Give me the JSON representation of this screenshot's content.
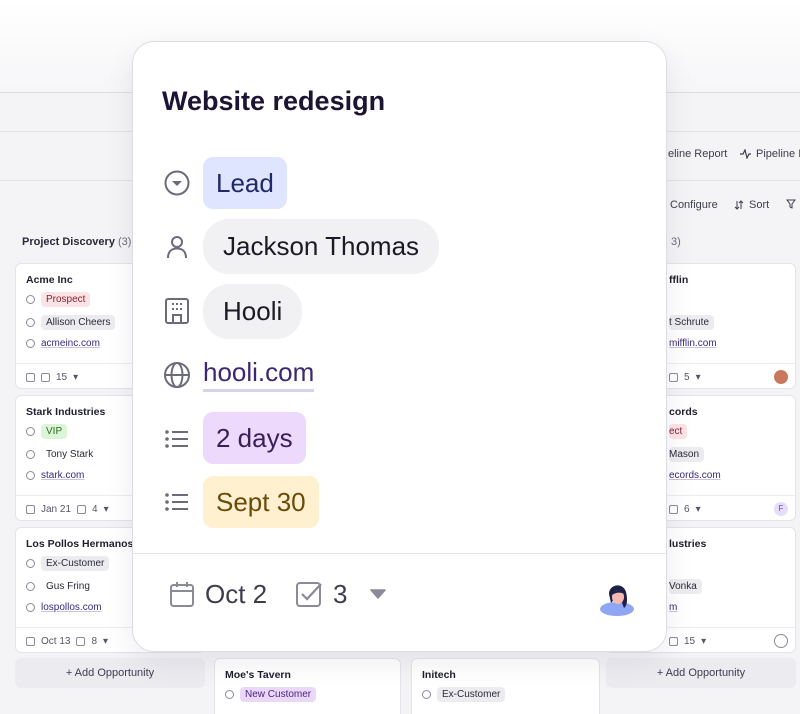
{
  "modal": {
    "title": "Website redesign",
    "status": "Lead",
    "contact": "Jackson Thomas",
    "company": "Hooli",
    "website": "hooli.com",
    "duration": "2 days",
    "due_date": "Sept 30",
    "footer": {
      "date": "Oct 2",
      "tasks": "3"
    }
  },
  "background": {
    "toolbar": {
      "pipeline_report": "eline Report",
      "pipeline_insights": "Pipeline In",
      "configure": "Configure",
      "sort": "Sort"
    },
    "columns": [
      {
        "title": "Project Discovery",
        "count": "(3)"
      },
      {
        "title": "",
        "count": "3)"
      }
    ],
    "cards_left": [
      {
        "title": "Acme Inc",
        "status": "Prospect",
        "contact": "Allison Cheers",
        "website": "acmeinc.com",
        "tasks": "15"
      },
      {
        "title": "Stark Industries",
        "status": "VIP",
        "contact": "Tony Stark",
        "website": "stark.com",
        "date": "Jan 21",
        "tasks": "4"
      },
      {
        "title": "Los Pollos Hermanos",
        "status": "Ex-Customer",
        "contact": "Gus Fring",
        "website": "lospollos.com",
        "date": "Oct 13",
        "tasks": "8"
      }
    ],
    "cards_right": [
      {
        "title": "fflin",
        "contact": "t Schrute",
        "website": "mifflin.com",
        "tasks": "5"
      },
      {
        "title": "cords",
        "status": "ect",
        "contact": "Mason",
        "website": "ecords.com",
        "tasks": "6",
        "avatar_letter": "F"
      },
      {
        "title": "lustries",
        "contact": "Vonka",
        "website": "m",
        "tasks": "15"
      }
    ],
    "bottom_cards": [
      {
        "title": "Moe's Tavern",
        "status": "New Customer"
      },
      {
        "title": "Initech",
        "status": "Ex-Customer"
      }
    ],
    "add_opportunity": "+ Add Opportunity",
    "add_opportunity_right": "+ Add Opportunity"
  },
  "colors": {
    "accent": "#3b2773",
    "lead_bg": "#dfe4ff",
    "duration_bg": "#ecd9fb",
    "due_bg": "#fff0d0"
  },
  "icons": [
    "status-icon",
    "person-icon",
    "building-icon",
    "globe-icon",
    "list-icon",
    "calendar-icon",
    "checkbox-icon",
    "caret-down-icon"
  ]
}
